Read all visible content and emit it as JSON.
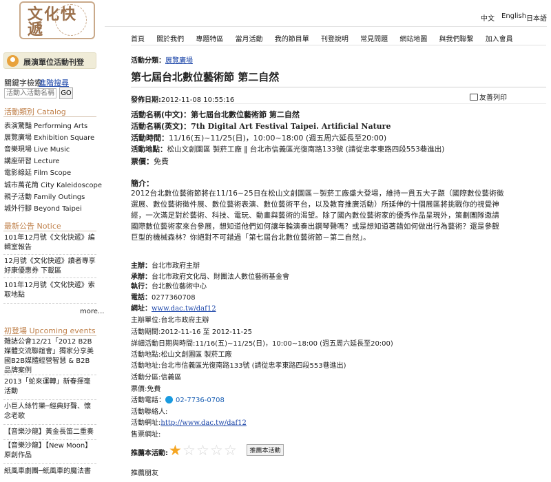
{
  "logo": {
    "text": "文化快遞"
  },
  "sidebar": {
    "publish_label": "展演單位活動刊登",
    "search_label": "關鍵字檢索",
    "advanced_search": "進階搜尋",
    "search_placeholder": "活動入活動名稱",
    "search_go": "GO",
    "catalog_head": "活動類別 Catalog",
    "catalog": [
      "表演驚豔 Performing Arts",
      "展覽廣場 Exhibition Square",
      "音樂現場 Live Music",
      "講座研習 Lecture",
      "電影線延 Film Scope",
      "城市萬花筒 City Kaleidoscope",
      "親子活動 Family Outings",
      "城外行腳 Beyond Taipei"
    ],
    "notice_head": "最新公告 Notice",
    "notices": [
      "101年12月號《文化快遞》編輯室報告",
      "12月號《文化快遞》讀者專享好康優惠券 下載區",
      "101年12月號《文化快遞》索取地點"
    ],
    "more": "more...",
    "upcoming_head": "初登場 Upcoming events",
    "upcoming": [
      "雜誌公會12/21「2012 B2B媒體交流聯誼會」獨家分享美國B2B媒體經營智慧 & B2B品牌案例",
      "2013「蛇來運轉」新春揮毫活動",
      "小巨人絲竹樂─經典好聲、懷念老歌",
      "【音樂沙龍】黃金長笛二重奏",
      "【音樂沙龍】【New Moon】原創作品",
      "紙風車劇團─紙風車的魔法書"
    ]
  },
  "header": {
    "languages": [
      "中文",
      "English",
      "日本語"
    ],
    "nav": [
      "首頁",
      "關於我們",
      "專題特區",
      "當月活動",
      "我的節目單",
      "刊登說明",
      "常見問題",
      "網站地圖",
      "與我們聯繫",
      "加入會員"
    ]
  },
  "main": {
    "category_label": "活動分類：",
    "category_value": "展覽廣場",
    "title": "第七屆台北數位藝術節 第二自然",
    "date_label": "發佈日期:",
    "date_value": "2012-11-08 10:55:16",
    "print_label": "友善列印",
    "info": {
      "name_zh_label": "活動名稱(中文)：",
      "name_zh": "第七屆台北數位藝術節 第二自然",
      "name_en_label": "活動名稱(英文)：",
      "name_en": "7th Digital Art Festival Taipei. Artificial Nature",
      "time_label": "活動時間：",
      "time": "11/16(五)~11/25(日)，10:00~18:00 (週五周六延長至20:00)",
      "place_label": "活動地點：",
      "place": "松山文創園區 製菸工廠 ‖ 台北市信義區光復南路133號 (請從忠孝東路四段553巷進出)",
      "fee_label": "票價：",
      "fee": "免費"
    },
    "intro_label": "簡介：",
    "intro": "2012台北數位藝術節將在11/16~25日在松山文創園區－製菸工廠盛大登場，維持一貫五大子題（國際數位藝術徵選展、數位藝術徵件展、數位藝術表演、數位藝術平台，以及教育推廣活動）所延伸的十個展區將挑戰你的視覺神經，一次滿足對於藝術、科技、電玩、動畫與藝術的渴望。除了國內數位藝術家的優秀作品呈現外，策劃團隊邀請國際數位藝術家來台參展，想知道他們如何讓年輪演奏出鋼琴聲嗎？或是想知道著錯如何做出行為藝術？還是參觀巨型的機械森林？你絕對不可錯過「第七屆台北數位藝術節－第二自然」。",
    "details": {
      "host_label": "主辦：",
      "host": "台北市政府主辦",
      "organizer_label": "承辦：",
      "organizer": "台北市政府文化局、財團法人數位藝術基金會",
      "executor_label": "執行：",
      "executor": "台北數位藝術中心",
      "phone_label": "電話：",
      "phone": "0277360708",
      "site_label": "網址：",
      "site": "www.dac.tw/daf12",
      "host_unit": "主辦單位:台北市政府主辦",
      "period": "活動期間:2012-11-16 至 2012-11-25",
      "detail_time": "詳細活動日期與時間:11/16(五)~11/25(日)，10:00~18:00 (週五周六延長至20:00)",
      "detail_place": "活動地點:松山文創園區 製菸工廠",
      "address": "活動地址:台北市信義區光復南路133號 (請從忠孝東路四段553巷進出)",
      "district": "活動分區:信義區",
      "ticket": "票價:免費",
      "tel_label": "活動電話：",
      "tel": "02-7736-0708",
      "contact": "活動聯絡人:",
      "web_label": "活動網址:",
      "web": "http://www.dac.tw/daf12",
      "ticket_site": "售票網址:"
    },
    "recommend_label": "推薦本活動:",
    "rating": 1,
    "rating_max": 5,
    "recommend_button": "推薦本活動",
    "friends": "推薦朋友"
  },
  "colors": {
    "link": "#1a44a8",
    "sidebar_head": "#c0814b",
    "star_on": "#f5a623",
    "star_off": "#d7d7d7"
  }
}
